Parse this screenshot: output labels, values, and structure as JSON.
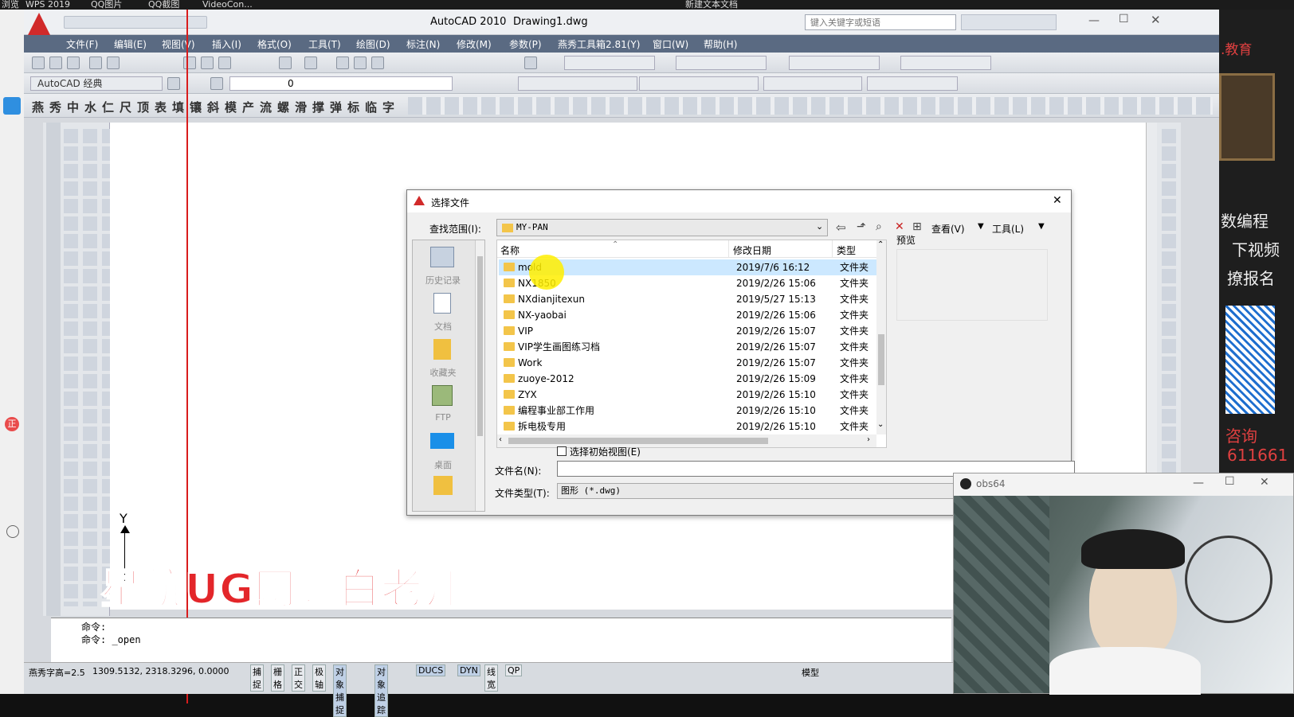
{
  "taskbar": {
    "items": [
      "浏览",
      "WPS 2019",
      "QQ图片",
      "QQ截图",
      "VideoCon...",
      "新建文本文档"
    ]
  },
  "cad": {
    "title": "AutoCAD 2010",
    "document": "Drawing1.dwg",
    "search_placeholder": "键入关键字或短语",
    "menu": [
      "文件(F)",
      "编辑(E)",
      "视图(V)",
      "插入(I)",
      "格式(O)",
      "工具(T)",
      "绘图(D)",
      "标注(N)",
      "修改(M)",
      "参数(P)",
      "燕秀工具箱2.81(Y)",
      "窗口(W)",
      "帮助(H)"
    ],
    "workspace": "AutoCAD 经典",
    "layer_value": "0",
    "chinese_toolbar": [
      "燕",
      "秀",
      "中",
      "水",
      "仁",
      "尺",
      "顶",
      "表",
      "填",
      "镶",
      "斜",
      "模",
      "产",
      "流",
      "螺",
      "滑",
      "撑",
      "弹",
      "标",
      "临",
      "字"
    ],
    "ucs_label": "Y",
    "command_lines": [
      "命令:",
      "命令:  _open"
    ],
    "status_left": "燕秀字高=2.5",
    "coordinates": "1309.5132, 2318.3296, 0.0000",
    "status_buttons": [
      "捕捉",
      "栅格",
      "正交",
      "极轴",
      "对象捕捉",
      "对象追踪",
      "DUCS",
      "DYN",
      "线宽",
      "QP"
    ],
    "status_right": [
      "模型"
    ]
  },
  "dialog": {
    "title": "选择文件",
    "lookin_label": "查找范围(I):",
    "lookin_value": "MY-PAN",
    "view_label": "查看(V)",
    "tools_label": "工具(L)",
    "preview_label": "预览",
    "places": [
      "历史记录",
      "文档",
      "收藏夹",
      "FTP",
      "桌面"
    ],
    "columns": {
      "name": "名称",
      "date": "修改日期",
      "type": "类型"
    },
    "files": [
      {
        "name": "mold",
        "date": "2019/7/6 16:12",
        "type": "文件夹"
      },
      {
        "name": "NX1850",
        "date": "2019/2/26 15:06",
        "type": "文件夹"
      },
      {
        "name": "NXdianjitexun",
        "date": "2019/5/27 15:13",
        "type": "文件夹"
      },
      {
        "name": "NX-yaobai",
        "date": "2019/2/26 15:06",
        "type": "文件夹"
      },
      {
        "name": "VIP",
        "date": "2019/2/26 15:07",
        "type": "文件夹"
      },
      {
        "name": "VIP学生画图练习档",
        "date": "2019/2/26 15:07",
        "type": "文件夹"
      },
      {
        "name": "Work",
        "date": "2019/2/26 15:07",
        "type": "文件夹"
      },
      {
        "name": "zuoye-2012",
        "date": "2019/2/26 15:09",
        "type": "文件夹"
      },
      {
        "name": "ZYX",
        "date": "2019/2/26 15:10",
        "type": "文件夹"
      },
      {
        "name": "编程事业部工作用",
        "date": "2019/2/26 15:10",
        "type": "文件夹"
      },
      {
        "name": "拆电极专用",
        "date": "2019/2/26 15:10",
        "type": "文件夹"
      }
    ],
    "initial_view_label": "选择初始视图(E)",
    "filename_label": "文件名(N):",
    "filename_value": "",
    "filetype_label": "文件类型(T):",
    "filetype_value": "图形 (*.dwg)"
  },
  "obs": {
    "title": "obs64"
  },
  "watermark": "星航UG网耀白老师",
  "side_overlay": {
    "lines": [
      ".教育",
      "数编程",
      "下视频",
      "撩报名",
      "咨询",
      "611661"
    ]
  }
}
